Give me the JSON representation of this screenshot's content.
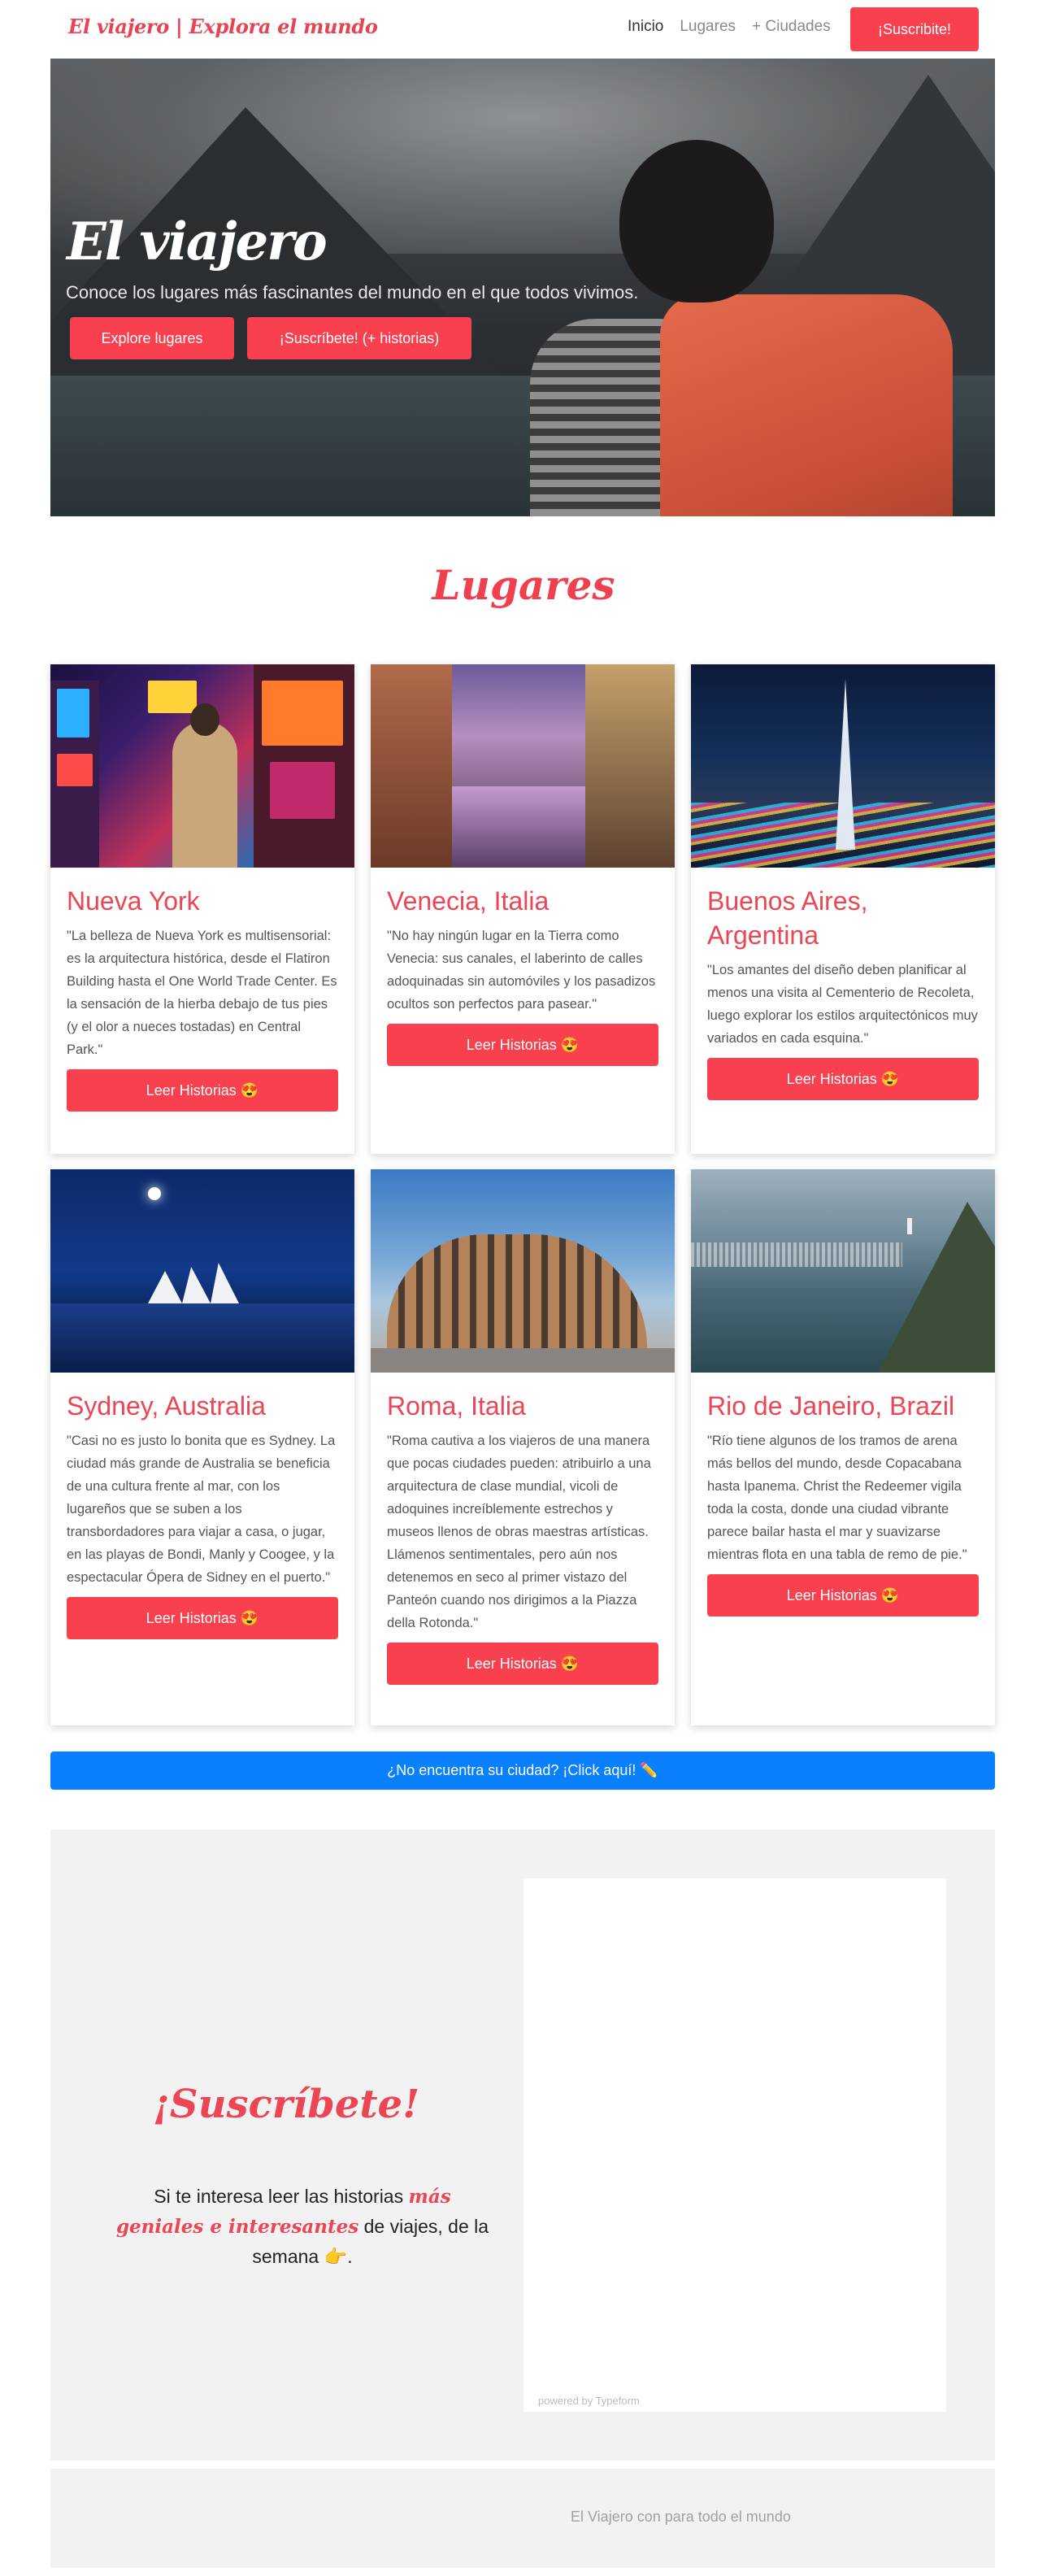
{
  "navbar": {
    "brand": "El viajero | Explora el mundo",
    "links": [
      {
        "label": "Inicio",
        "active": true
      },
      {
        "label": "Lugares",
        "active": false
      },
      {
        "label": "+ Ciudades",
        "active": false
      }
    ],
    "cta": "¡Suscribite!"
  },
  "hero": {
    "title": "El viajero",
    "tagline": "Conoce los lugares más fascinantes del mundo en el que todos vivimos.",
    "explore_button": "Explore lugares",
    "subscribe_button": "¡Suscríbete! (+ historias)"
  },
  "places": {
    "title": "Lugares",
    "read_button": "Leer Historias 😍",
    "cards": [
      {
        "title": "Nueva York",
        "description": "\"La belleza de Nueva York es multisensorial: es la arquitectura histórica, desde el Flatiron Building hasta el One World Trade Center. Es la sensación de la hierba debajo de tus pies (y el olor a nueces tostadas) en Central Park.\""
      },
      {
        "title": "Venecia, Italia",
        "description": "\"No hay ningún lugar en la Tierra como Venecia: sus canales, el laberinto de calles adoquinadas sin automóviles y los pasadizos ocultos son perfectos para pasear.\""
      },
      {
        "title": "Buenos Aires, Argentina",
        "description": "\"Los amantes del diseño deben planificar al menos una visita al Cementerio de Recoleta, luego explorar los estilos arquitectónicos muy variados en cada esquina.\""
      },
      {
        "title": "Sydney, Australia",
        "description": "\"Casi no es justo lo bonita que es Sydney. La ciudad más grande de Australia se beneficia de una cultura frente al mar, con los lugareños que se suben a los transbordadores para viajar a casa, o jugar, en las playas de Bondi, Manly y Coogee, y la espectacular Ópera de Sidney en el puerto.\""
      },
      {
        "title": "Roma, Italia",
        "description": "\"Roma cautiva a los viajeros de una manera que pocas ciudades pueden: atribuirlo a una arquitectura de clase mundial, vicoli de adoquines increíblemente estrechos y museos llenos de obras maestras artísticas. Llámenos sentimentales, pero aún nos detenemos en seco al primer vistazo del Panteón cuando nos dirigimos a la Piazza della Rotonda.\""
      },
      {
        "title": "Rio de Janeiro, Brazil",
        "description": "\"Río tiene algunos de los tramos de arena más bellos del mundo, desde Copacabana hasta Ipanema. Christ the Redeemer vigila toda la costa, donde una ciudad vibrante parece bailar hasta el mar y suavizarse mientras flota en una tabla de remo de pie.\""
      }
    ]
  },
  "city_button": "¿No encuentra su ciudad? ¡Click aquí! ✏️",
  "subscribe": {
    "title": "¡Suscríbete!",
    "text_before": "Si te interesa leer las historias ",
    "highlight": "más geniales e interesantes",
    "text_after": " de viajes, de la semana 👉.",
    "powered_by": "powered by Typeform"
  },
  "footer": {
    "text": "El Viajero con para todo el mundo"
  },
  "colors": {
    "accent": "#f8404e",
    "title_red": "#ec4553",
    "blue_button": "#0b80ff",
    "section_bg": "#f2f2f2"
  }
}
